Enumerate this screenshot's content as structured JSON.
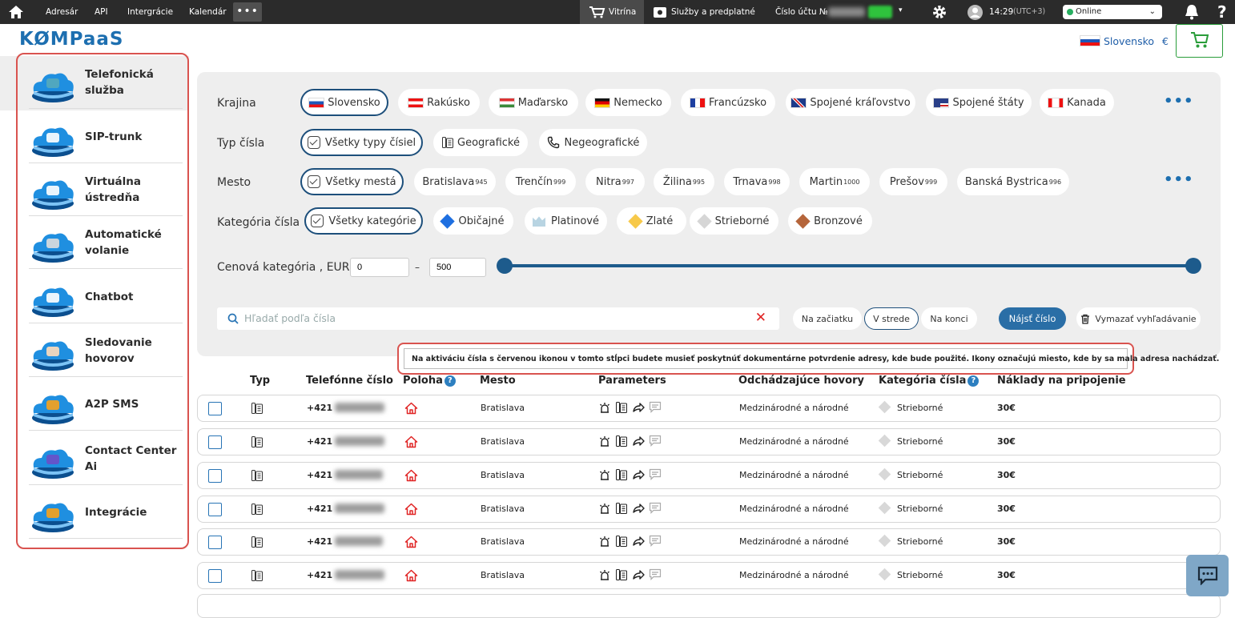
{
  "topbar": {
    "nav": [
      "Adresár",
      "API",
      "Intergrácie",
      "Kalendár"
    ],
    "more": "•••",
    "vitrina": "Vitrína",
    "services": "Služby a predplatné",
    "account": "Číslo účtu №",
    "time": "14:29",
    "timezone": "(UTC+3)",
    "status": "Online"
  },
  "header": {
    "logo": "KØMPaaS",
    "region": "Slovensko",
    "currency": "€"
  },
  "sidebar": {
    "items": [
      {
        "label": "Telefonická služba",
        "icon": "telephone-cloud-icon"
      },
      {
        "label": "SIP-trunk",
        "icon": "sip-phone-cloud-icon"
      },
      {
        "label": "Virtuálna ústredňa",
        "icon": "virtual-pbx-cloud-icon"
      },
      {
        "label": "Automatické volanie",
        "icon": "auto-dialer-cloud-icon"
      },
      {
        "label": "Chatbot",
        "icon": "chatbot-cloud-icon"
      },
      {
        "label": "Sledovanie hovorov",
        "icon": "call-tracking-cloud-icon"
      },
      {
        "label": "A2P SMS",
        "icon": "sms-cloud-icon"
      },
      {
        "label": "Contact Center Ai",
        "icon": "contact-center-cloud-icon"
      },
      {
        "label": "Integrácie",
        "icon": "integrations-cloud-icon"
      }
    ]
  },
  "filters": {
    "country_label": "Krajina",
    "countries": [
      "Slovensko",
      "Rakúsko",
      "Maďarsko",
      "Nemecko",
      "Francúzsko",
      "Spojené kráľovstvo",
      "Spojené štáty",
      "Kanada"
    ],
    "type_label": "Typ čísla",
    "types": [
      "Všetky typy čísiel",
      "Geografické",
      "Negeografické"
    ],
    "city_label": "Mesto",
    "cities_all": "Všetky mestá",
    "cities": [
      {
        "name": "Bratislava",
        "count": "945"
      },
      {
        "name": "Trenčín",
        "count": "999"
      },
      {
        "name": "Nitra",
        "count": "997"
      },
      {
        "name": "Žilina",
        "count": "995"
      },
      {
        "name": "Trnava",
        "count": "998"
      },
      {
        "name": "Martin",
        "count": "1000"
      },
      {
        "name": "Prešov",
        "count": "999"
      },
      {
        "name": "Banská Bystrica",
        "count": "996"
      }
    ],
    "category_label": "Kategória čísla",
    "categories": [
      "Všetky kategórie",
      "Običajné",
      "Platinové",
      "Zlaté",
      "Strieborné",
      "Bronzové"
    ],
    "price_label": "Cenová kategória , EUR",
    "price_min": "0",
    "price_max": "500",
    "price_sep": "–",
    "search_placeholder": "Hľadať podľa čísla",
    "positions": [
      "Na začiatku",
      "V strede",
      "Na konci"
    ],
    "find": "Nájsť číslo",
    "clear": "Vymazať vyhľadávanie",
    "more": "•••"
  },
  "tooltip": "Na aktiváciu čísla s červenou ikonou v tomto stĺpci budete musieť poskytnúť dokumentárne potvrdenie adresy, kde bude použité. Ikony označujú miesto, kde by sa mala adresa nachádzať.",
  "table": {
    "headers": [
      "Typ",
      "Telefónne číslo",
      "Poloha",
      "Mesto",
      "Parameters",
      "Odchádzajúce hovory",
      "Kategória čísla",
      "Náklady na pripojenie"
    ],
    "rows": [
      {
        "prefix": "+421",
        "city": "Bratislava",
        "calls": "Medzinárodné a národné",
        "category": "Strieborné",
        "cost": "30€"
      },
      {
        "prefix": "+421",
        "city": "Bratislava",
        "calls": "Medzinárodné a národné",
        "category": "Strieborné",
        "cost": "30€"
      },
      {
        "prefix": "+421",
        "city": "Bratislava",
        "calls": "Medzinárodné a národné",
        "category": "Strieborné",
        "cost": "30€"
      },
      {
        "prefix": "+421",
        "city": "Bratislava",
        "calls": "Medzinárodné a národné",
        "category": "Strieborné",
        "cost": "30€"
      },
      {
        "prefix": "+421",
        "city": "Bratislava",
        "calls": "Medzinárodné a národné",
        "category": "Strieborné",
        "cost": "30€"
      },
      {
        "prefix": "+421",
        "city": "Bratislava",
        "calls": "Medzinárodné a národné",
        "category": "Strieborné",
        "cost": "30€"
      }
    ]
  },
  "colors": {
    "topbar": "#2b2b2b",
    "accent": "#1d5b8c",
    "highlight": "#d9534f",
    "address_icon": "#e02424"
  }
}
